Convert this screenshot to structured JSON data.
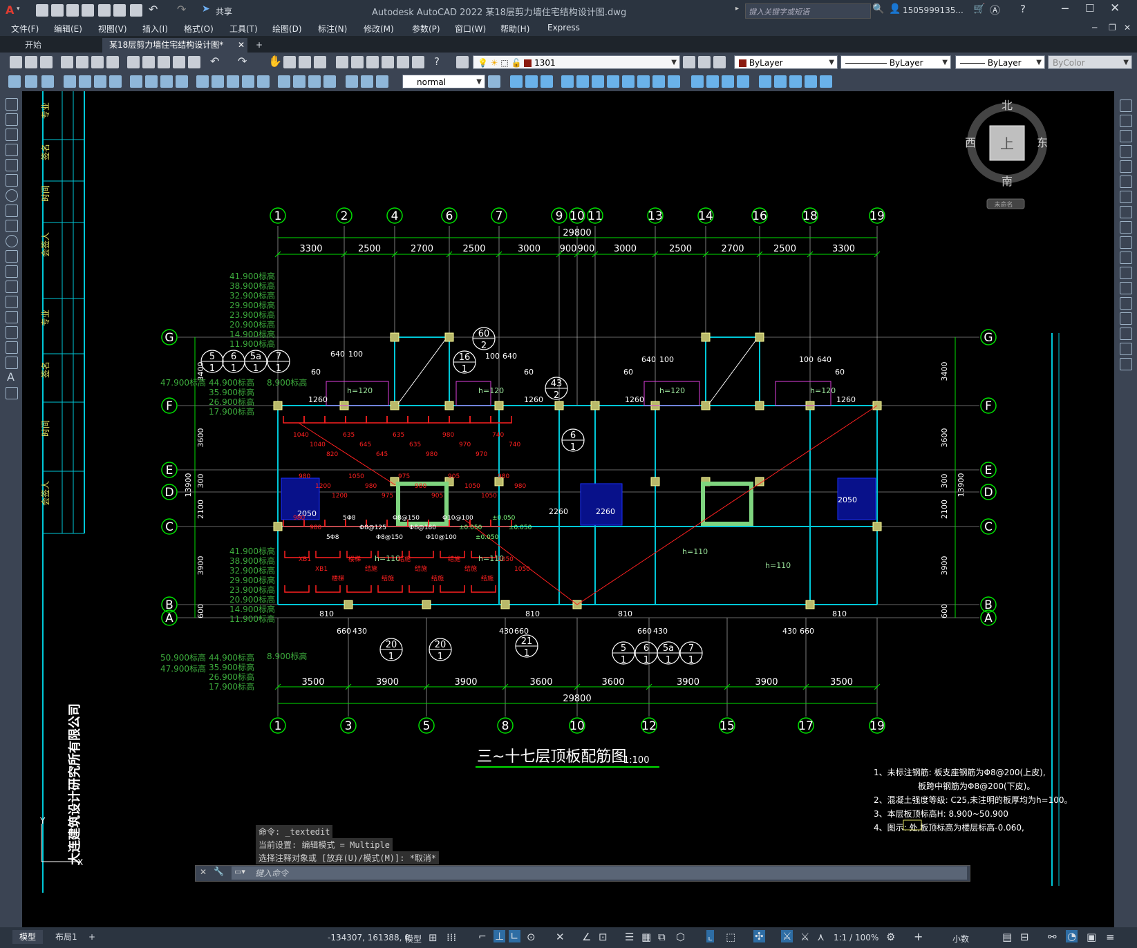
{
  "app": {
    "title": "Autodesk AutoCAD 2022    某18层剪力墙住宅结构设计图.dwg",
    "search_placeholder": "键入关键字或短语",
    "user": "1505999135...",
    "share": "共享",
    "logo": "A"
  },
  "menu": [
    "文件(F)",
    "编辑(E)",
    "视图(V)",
    "插入(I)",
    "格式(O)",
    "工具(T)",
    "绘图(D)",
    "标注(N)",
    "修改(M)",
    "参数(P)",
    "窗口(W)",
    "帮助(H)",
    "Express"
  ],
  "tabs": {
    "start": "开始",
    "active": "某18层剪力墙住宅结构设计图*",
    "add": "+"
  },
  "toolbar": {
    "layer": "1301",
    "color": "ByLayer",
    "linetype": "ByLayer",
    "lineweight": "ByLayer",
    "plotstyle": "ByColor",
    "textstyle": "normal"
  },
  "viewcube": {
    "n": "北",
    "s": "南",
    "e": "东",
    "w": "西",
    "top": "上",
    "wcs": "未命名"
  },
  "drawing": {
    "title": "三~十七层顶板配筋图",
    "scale": "1:100",
    "overall": "29800",
    "top_axes": [
      "1",
      "2",
      "4",
      "6",
      "7",
      "9",
      "10",
      "11",
      "13",
      "14",
      "16",
      "18",
      "19"
    ],
    "top_dims": [
      "3300",
      "2500",
      "2700",
      "2500",
      "3000",
      "900",
      "900",
      "3000",
      "2500",
      "2700",
      "2500",
      "3300"
    ],
    "bottom_axes": [
      "1",
      "3",
      "5",
      "8",
      "10",
      "12",
      "15",
      "17",
      "19"
    ],
    "bottom_dims": [
      "3500",
      "3900",
      "3900",
      "3600",
      "3600",
      "3900",
      "3900",
      "3500"
    ],
    "row_axes": [
      "G",
      "F",
      "E",
      "D",
      "C",
      "B",
      "A"
    ],
    "left_dims": [
      "3400",
      "3600",
      "300",
      "2100",
      "3900",
      "600"
    ],
    "total_height": "13900",
    "elev_top_left": [
      "41.900标高",
      "38.900标高",
      "32.900标高",
      "29.900标高",
      "23.900标高",
      "20.900标高",
      "14.900标高",
      "11.900标高"
    ],
    "elev_mid_left": [
      "47.900标高",
      "44.900标高",
      "35.900标高",
      "26.900标高",
      "17.900标高"
    ],
    "elev_mid_right": "8.900标高",
    "elev_bot_left": [
      "50.900标高",
      "47.900标高"
    ],
    "elev_bot_mid": [
      "44.900标高",
      "35.900标高",
      "26.900标高",
      "17.900标高"
    ],
    "elev_lower_left": [
      "41.900标高",
      "38.900标高",
      "32.900标高",
      "29.900标高",
      "23.900标高",
      "20.900标高",
      "14.900标高",
      "11.900标高"
    ],
    "elev_lower_right": "8.900标高",
    "note_items": [
      "1、未标注钢筋: 板支座钢筋为Φ8@200(上皮),",
      "板跨中钢筋为Φ8@200(下皮)。",
      "2、混凝土强度等级: C25,未注明的板厚均为h=100。",
      "3、本层板顶标高H: 8.900~50.900",
      "4、图示:        处,板顶标高为楼层标高-0.060,"
    ],
    "company": "大连建筑设计研究所有限公司",
    "title_block": [
      "专业",
      "签名",
      "时间",
      "会签人",
      "专业",
      "签名",
      "时间",
      "会签人"
    ],
    "slab_labels": [
      "h=120",
      "h=120",
      "h=120",
      "h=120",
      "h=110",
      "h=110",
      "h=110",
      "h=110"
    ],
    "dim_misc": [
      "640",
      "100",
      "100",
      "640",
      "640",
      "100",
      "100",
      "640",
      "60",
      "60",
      "60",
      "60",
      "1260",
      "1260",
      "1260",
      "1260",
      "2050",
      "2050",
      "2260",
      "2260",
      "660",
      "430",
      "430",
      "660",
      "660",
      "430",
      "430",
      "660",
      "810",
      "810",
      "810",
      "810"
    ],
    "detail_refs": [
      "60/2",
      "16/1",
      "43/2",
      "6/1",
      "5/1",
      "6/1",
      "5a/1",
      "7/1",
      "20/1",
      "20/1",
      "21/1",
      "5/1",
      "6/1",
      "5a/1",
      "7/1"
    ],
    "rebar_small": [
      "1040",
      "1040",
      "820",
      "635",
      "645",
      "645",
      "635",
      "635",
      "980",
      "980",
      "970",
      "970",
      "740",
      "740",
      "980",
      "1200",
      "1200",
      "1050",
      "980",
      "975",
      "975",
      "980",
      "905",
      "905",
      "1050",
      "1050",
      "980",
      "980",
      "980",
      "980",
      "5Φ8",
      "5Φ8",
      "Φ8@125",
      "Φ8@150",
      "Φ8@150",
      "Φ8@180",
      "Φ10@100",
      "Φ10@100",
      "±0.050",
      "±0.050",
      "±0.050",
      "±0.050",
      "XB1",
      "XB1",
      "楼梯",
      "楼梯",
      "结施",
      "结施",
      "结施",
      "结施",
      "结施",
      "结施",
      "结施",
      "结施",
      "1050",
      "1050"
    ]
  },
  "command": {
    "line1": "命令: _textedit",
    "line2": "当前设置: 编辑模式 = Multiple",
    "line3": "选择注释对象或 [放弃(U)/模式(M)]: *取消*",
    "placeholder": "键入命令"
  },
  "status": {
    "coords": "-134307, 161388, 0",
    "model": "模型",
    "scale": "1:1 / 100%",
    "units": "小数",
    "tabs": [
      "模型",
      "布局1",
      "+"
    ]
  }
}
